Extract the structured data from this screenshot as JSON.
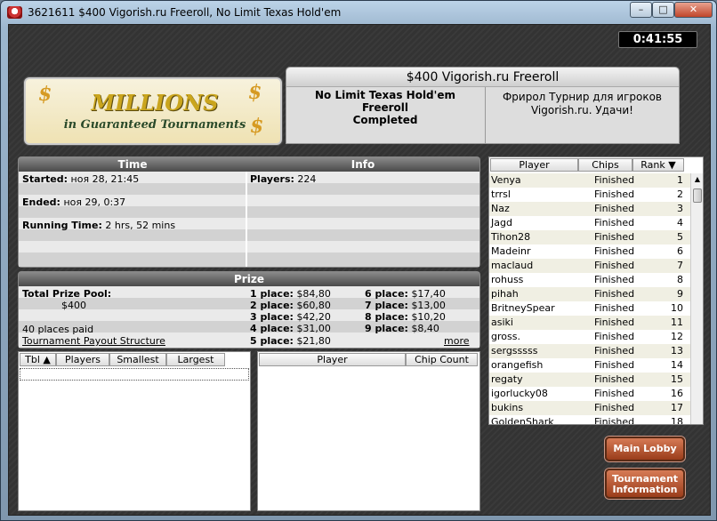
{
  "window": {
    "title": "3621611 $400 Vigorish.ru Freeroll, No Limit Texas Hold'em",
    "min": "–",
    "max": "□",
    "close": "✕"
  },
  "clock": "0:41:55",
  "banner": {
    "title": "MILLIONS",
    "subtitle": "in Guaranteed Tournaments"
  },
  "info": {
    "title": "$400 Vigorish.ru Freeroll",
    "game": "No Limit Texas Hold'em",
    "type": "Freeroll",
    "status": "Completed",
    "description": "Фрирол Турнир для игроков Vigorish.ru. Удачи!"
  },
  "time": {
    "header": "Time",
    "started_label": "Started:",
    "started_value": "ноя 28, 21:45",
    "ended_label": "Ended:",
    "ended_value": "ноя 29, 0:37",
    "running_label": "Running Time:",
    "running_value": "2 hrs, 52 mins"
  },
  "infobox": {
    "header": "Info",
    "players_label": "Players:",
    "players_value": "224"
  },
  "prize": {
    "header": "Prize",
    "pool_label": "Total Prize Pool:",
    "pool_value": "$400",
    "paid": "40 places paid",
    "payout_link": "Tournament Payout Structure",
    "more": "more",
    "places": [
      {
        "label": "1 place:",
        "value": "$84,80"
      },
      {
        "label": "2 place:",
        "value": "$60,80"
      },
      {
        "label": "3 place:",
        "value": "$42,20"
      },
      {
        "label": "4 place:",
        "value": "$31,00"
      },
      {
        "label": "5 place:",
        "value": "$21,80"
      },
      {
        "label": "6 place:",
        "value": "$17,40"
      },
      {
        "label": "7 place:",
        "value": "$13,00"
      },
      {
        "label": "8 place:",
        "value": "$10,20"
      },
      {
        "label": "9 place:",
        "value": "$8,40"
      }
    ]
  },
  "tables": {
    "columns": [
      "Tbl ▲",
      "Players",
      "Smallest",
      "Largest"
    ]
  },
  "chips": {
    "columns": [
      "Player",
      "Chip Count"
    ]
  },
  "ranking": {
    "columns": [
      "Player",
      "Chips",
      "Rank ▼"
    ],
    "rows": [
      {
        "name": "Venya",
        "chips": "Finished",
        "rank": "1"
      },
      {
        "name": "trrsl",
        "chips": "Finished",
        "rank": "2"
      },
      {
        "name": "Naz",
        "chips": "Finished",
        "rank": "3"
      },
      {
        "name": "Jagd",
        "chips": "Finished",
        "rank": "4"
      },
      {
        "name": "Tihon28",
        "chips": "Finished",
        "rank": "5"
      },
      {
        "name": "Madeinr",
        "chips": "Finished",
        "rank": "6"
      },
      {
        "name": "maclaud",
        "chips": "Finished",
        "rank": "7"
      },
      {
        "name": "rohuss",
        "chips": "Finished",
        "rank": "8"
      },
      {
        "name": "pihah",
        "chips": "Finished",
        "rank": "9"
      },
      {
        "name": "BritneySpear",
        "chips": "Finished",
        "rank": "10"
      },
      {
        "name": "asiki",
        "chips": "Finished",
        "rank": "11"
      },
      {
        "name": "gross.",
        "chips": "Finished",
        "rank": "12"
      },
      {
        "name": "sergsssss",
        "chips": "Finished",
        "rank": "13"
      },
      {
        "name": "orangefish",
        "chips": "Finished",
        "rank": "14"
      },
      {
        "name": "regaty",
        "chips": "Finished",
        "rank": "15"
      },
      {
        "name": "igorlucky08",
        "chips": "Finished",
        "rank": "16"
      },
      {
        "name": "bukins",
        "chips": "Finished",
        "rank": "17"
      },
      {
        "name": "GoldenShark",
        "chips": "Finished",
        "rank": "18"
      }
    ]
  },
  "buttons": {
    "main_lobby": "Main Lobby",
    "tournament_info_1": "Tournament",
    "tournament_info_2": "Information"
  }
}
